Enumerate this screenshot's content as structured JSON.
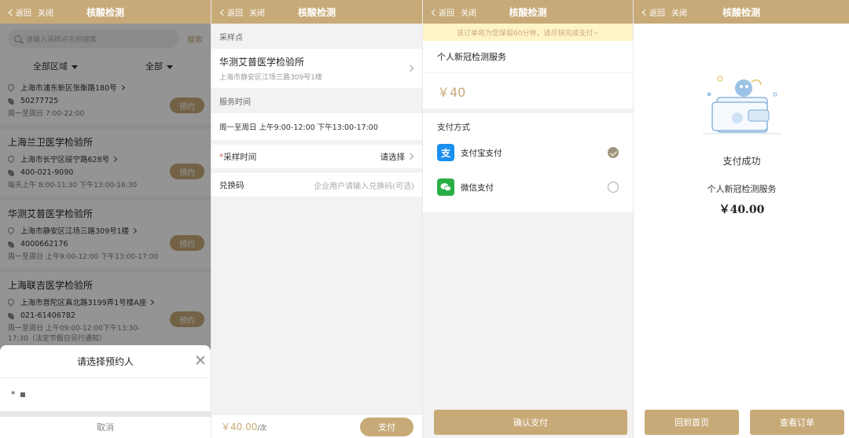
{
  "common": {
    "back_label": "返回",
    "close_label": "关闭",
    "title": "核酸检测"
  },
  "screen1": {
    "search_placeholder": "请输入采样点名称搜索",
    "search_button": "搜索",
    "filter_area": "全部区域",
    "filter_all": "全部",
    "book_label": "预约",
    "clinics": [
      {
        "name": "",
        "address": "上海市浦东新区张衡路180号",
        "phone": "50277725",
        "hours": "周一至周日 7:00-22:00"
      },
      {
        "name": "上海兰卫医学检验所",
        "address": "上海市长宁区绥宁路628号",
        "phone": "400-021-9090",
        "hours": "每天上午 8:00-11:30 下午13:00-16:30"
      },
      {
        "name": "华测艾普医学检验所",
        "address": "上海市静安区江场三路309号1楼",
        "phone": "4000662176",
        "hours": "周一至周日 上午9:00-12:00 下午13:00-17:00"
      },
      {
        "name": "上海联吉医学检验所",
        "address": "上海市普陀区真北路3199弄1号楼A座",
        "phone": "021-61406782",
        "hours": "周一至周日 上午09:00-12:00下午13:30-17:30（法定节假日另行通知）"
      }
    ],
    "sheet": {
      "title": "请选择预约人",
      "person_marker": "*",
      "cancel": "取消"
    }
  },
  "screen2": {
    "site_section": "采样点",
    "site_name": "华测艾普医学检验所",
    "site_address": "上海市静安区江场三路309号1楼",
    "time_section": "服务时间",
    "time_value": "周一至周日 上午9:00-12:00 下午13:00-17:00",
    "sample_time_required": "*",
    "sample_time_label": "采样时间",
    "sample_time_value": "请选择",
    "redeem_label": "兑换码",
    "redeem_placeholder": "企业用户请输入兑换码(可选)",
    "price": "￥40.00",
    "price_unit": "/次",
    "pay_button": "支付"
  },
  "screen3": {
    "notice": "该订单将为您保留60分钟，请尽快完成支付~",
    "service": "个人新冠检测服务",
    "amount": "￥40",
    "pay_method_label": "支付方式",
    "alipay_label": "支付宝支付",
    "alipay_glyph": "支",
    "wechat_label": "微信支付",
    "confirm_button": "确认支付",
    "selected_method": "alipay"
  },
  "screen4": {
    "success": "支付成功",
    "service": "个人新冠检测服务",
    "amount": "￥40.00",
    "home_button": "回到首页",
    "order_button": "查看订单"
  },
  "colors": {
    "accent": "#c7aa78",
    "notice_bg": "#fff4c8",
    "alipay": "#1a8ff0",
    "wechat": "#2aae46"
  }
}
